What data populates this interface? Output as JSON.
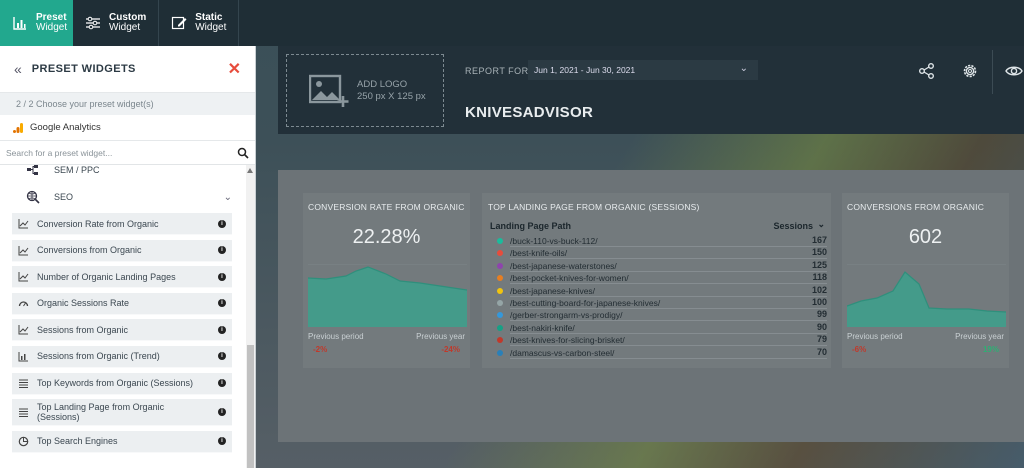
{
  "toolbar": {
    "tabs": [
      {
        "line1": "Preset",
        "line2": "Widget",
        "icon": "bar-chart-icon"
      },
      {
        "line1": "Custom",
        "line2": "Widget",
        "icon": "sliders-icon"
      },
      {
        "line1": "Static",
        "line2": "Widget",
        "icon": "edit-icon"
      }
    ]
  },
  "panel": {
    "title": "PRESET WIDGETS",
    "step": "2 / 2   Choose your preset widget(s)",
    "source": "Google Analytics",
    "search_placeholder": "Search for a preset widget...",
    "partial_category": "SEM / PPC",
    "category": "SEO",
    "items": [
      {
        "label": "Conversion Rate from Organic",
        "icon": "line-chart-icon"
      },
      {
        "label": "Conversions from Organic",
        "icon": "line-chart-icon"
      },
      {
        "label": "Number of Organic Landing Pages",
        "icon": "line-chart-icon"
      },
      {
        "label": "Organic Sessions Rate",
        "icon": "gauge-icon"
      },
      {
        "label": "Sessions from Organic",
        "icon": "line-chart-icon"
      },
      {
        "label": "Sessions from Organic (Trend)",
        "icon": "bar-trend-icon"
      },
      {
        "label": "Top Keywords from Organic (Sessions)",
        "icon": "list-icon"
      },
      {
        "label": "Top Landing Page from Organic (Sessions)",
        "icon": "list-icon"
      },
      {
        "label": "Top Search Engines",
        "icon": "pie-icon"
      }
    ]
  },
  "report": {
    "logo_line1": "ADD LOGO",
    "logo_line2": "250 px X 125 px",
    "report_for": "REPORT FOR",
    "date_range": "Jun 1, 2021 - Jun 30, 2021",
    "company": "KNIVESADVISOR"
  },
  "widgets": {
    "conv_rate": {
      "title": "CONVERSION RATE FROM ORGANIC",
      "value": "22.28%",
      "prev_period_label": "Previous period",
      "prev_year_label": "Previous year",
      "prev_period": "-2%",
      "prev_year": "-24%"
    },
    "top_landing": {
      "title": "TOP LANDING PAGE FROM ORGANIC (SESSIONS)",
      "col_path": "Landing Page Path",
      "col_sessions": "Sessions",
      "rows": [
        {
          "path": "/buck-110-vs-buck-112/",
          "sessions": "167",
          "color": "#1abc9c"
        },
        {
          "path": "/best-knife-oils/",
          "sessions": "150",
          "color": "#e74c3c"
        },
        {
          "path": "/best-japanese-waterstones/",
          "sessions": "125",
          "color": "#8e44ad"
        },
        {
          "path": "/best-pocket-knives-for-women/",
          "sessions": "118",
          "color": "#e67e22"
        },
        {
          "path": "/best-japanese-knives/",
          "sessions": "102",
          "color": "#f1c40f"
        },
        {
          "path": "/best-cutting-board-for-japanese-knives/",
          "sessions": "100",
          "color": "#95a5a6"
        },
        {
          "path": "/gerber-strongarm-vs-prodigy/",
          "sessions": "99",
          "color": "#3498db"
        },
        {
          "path": "/best-nakiri-knife/",
          "sessions": "90",
          "color": "#16a085"
        },
        {
          "path": "/best-knives-for-slicing-brisket/",
          "sessions": "79",
          "color": "#c0392b"
        },
        {
          "path": "/damascus-vs-carbon-steel/",
          "sessions": "70",
          "color": "#2980b9"
        }
      ]
    },
    "conversions": {
      "title": "CONVERSIONS FROM ORGANIC",
      "value": "602",
      "prev_period_label": "Previous period",
      "prev_year_label": "Previous year",
      "prev_period": "-6%",
      "prev_year": "19%"
    }
  },
  "colors": {
    "accent": "#22a88e",
    "topbar": "#1f2e36",
    "chart_fill": "#3f9e8c",
    "chart_line": "#2f8f7c"
  }
}
